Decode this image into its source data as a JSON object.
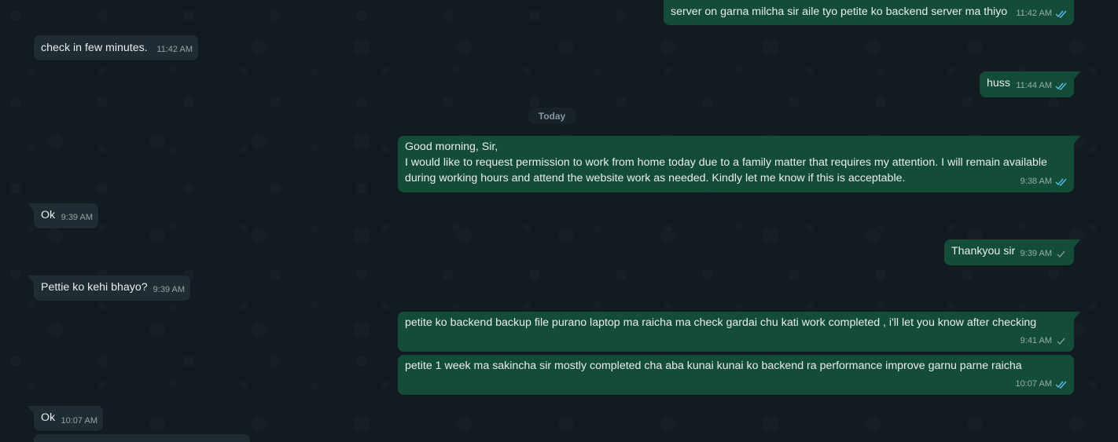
{
  "colors": {
    "background": "#111b21",
    "incoming_bubble": "#202c33",
    "outgoing_bubble": "#144d37",
    "read_tick": "#53bdeb",
    "sent_tick": "#8696a0"
  },
  "date_separator": "Today",
  "messages": [
    {
      "id": "m1",
      "direction": "outgoing",
      "text": "server on garna milcha sir aile tyo petite ko backend server ma thiyo",
      "time": "11:42 AM",
      "status": "read"
    },
    {
      "id": "m2",
      "direction": "incoming",
      "text": "check in few minutes.",
      "time": "11:42 AM"
    },
    {
      "id": "m3",
      "direction": "outgoing",
      "text": "huss",
      "time": "11:44 AM",
      "status": "read"
    },
    {
      "id": "m4",
      "direction": "outgoing",
      "text": "Good morning, Sir,\nI would like to request permission to work from home today due to a family matter that requires my attention. I will remain available\nduring working hours and attend the website work as needed. Kindly let me know if this is acceptable.",
      "time": "9:38 AM",
      "status": "read"
    },
    {
      "id": "m5",
      "direction": "incoming",
      "text": "Ok",
      "time": "9:39 AM"
    },
    {
      "id": "m6",
      "direction": "outgoing",
      "text": "Thankyou sir",
      "time": "9:39 AM",
      "status": "sent"
    },
    {
      "id": "m7",
      "direction": "incoming",
      "text": "Pettie ko kehi bhayo?",
      "time": "9:39 AM"
    },
    {
      "id": "m8",
      "direction": "outgoing",
      "text": "petite ko backend backup file purano laptop ma raicha ma check gardai chu kati work completed , i'll let you know after checking",
      "time": "9:41 AM",
      "status": "sent"
    },
    {
      "id": "m9",
      "direction": "outgoing",
      "text": "petite 1 week ma sakincha sir mostly completed cha aba kunai kunai ko backend ra performance improve garnu parne raicha",
      "time": "10:07 AM",
      "status": "read"
    },
    {
      "id": "m10",
      "direction": "incoming",
      "text": "Ok",
      "time": "10:07 AM"
    }
  ]
}
